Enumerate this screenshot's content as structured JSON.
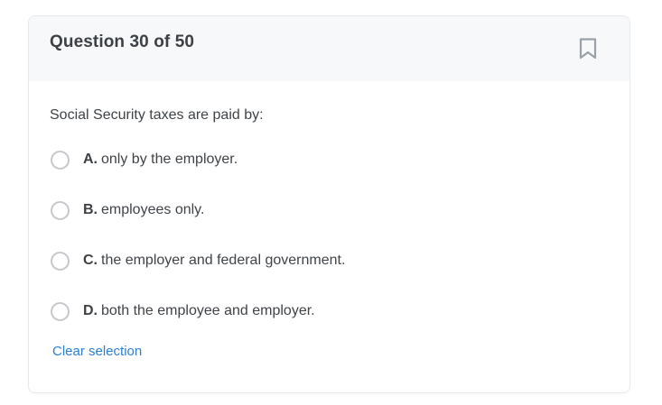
{
  "question": {
    "header_title": "Question 30 of 50",
    "text": "Social Security taxes are paid by:",
    "options": [
      {
        "letter": "A.",
        "text": "only by the employer."
      },
      {
        "letter": "B.",
        "text": "employees only."
      },
      {
        "letter": "C.",
        "text": "the employer and federal government."
      },
      {
        "letter": "D.",
        "text": "both the employee and employer."
      }
    ],
    "clear_label": "Clear selection"
  },
  "icons": {
    "bookmark": "bookmark-icon",
    "radio": "radio-unchecked"
  },
  "colors": {
    "header_bg": "#f7f8fa",
    "link": "#2a7fd4",
    "icon": "#9aa1a8",
    "radio_border": "#c4c8cc"
  }
}
